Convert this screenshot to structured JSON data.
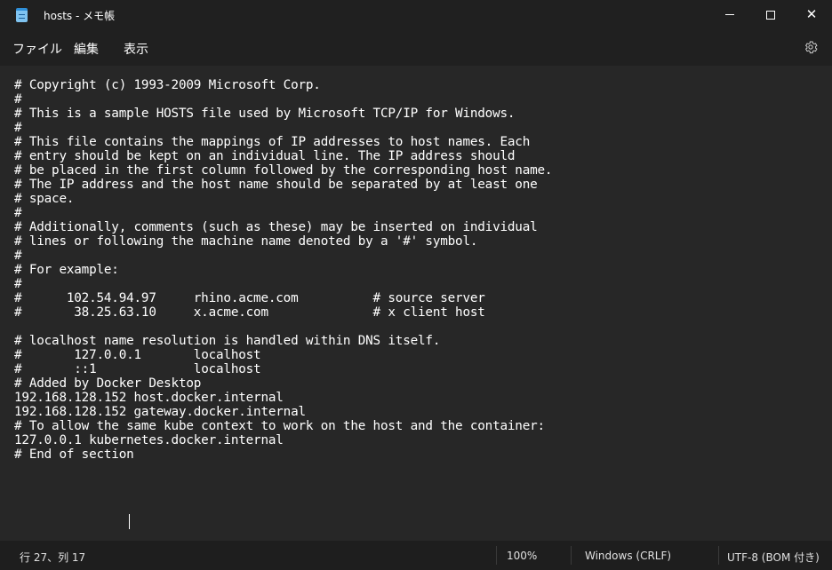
{
  "window": {
    "title": "hosts - メモ帳"
  },
  "menu": {
    "file": "ファイル",
    "edit": "編集",
    "view": "表示"
  },
  "editor": {
    "content": "# Copyright (c) 1993-2009 Microsoft Corp.\n#\n# This is a sample HOSTS file used by Microsoft TCP/IP for Windows.\n#\n# This file contains the mappings of IP addresses to host names. Each\n# entry should be kept on an individual line. The IP address should\n# be placed in the first column followed by the corresponding host name.\n# The IP address and the host name should be separated by at least one\n# space.\n#\n# Additionally, comments (such as these) may be inserted on individual\n# lines or following the machine name denoted by a '#' symbol.\n#\n# For example:\n#\n#      102.54.94.97     rhino.acme.com          # source server\n#       38.25.63.10     x.acme.com              # x client host\n\n# localhost name resolution is handled within DNS itself.\n#\t127.0.0.1       localhost\n#\t::1             localhost\n# Added by Docker Desktop\n192.168.128.152 host.docker.internal\n192.168.128.152 gateway.docker.internal\n# To allow the same kube context to work on the host and the container:\n127.0.0.1 kubernetes.docker.internal\n# End of section"
  },
  "status": {
    "position": "行 27、列 17",
    "zoom": "100%",
    "line_ending": "Windows (CRLF)",
    "encoding": "UTF-8 (BOM 付き)"
  },
  "icons": {
    "app": "notepad-icon",
    "settings": "gear-icon",
    "minimize": "minimize-icon",
    "maximize": "maximize-icon",
    "close": "close-icon"
  },
  "colors": {
    "background": "#272727",
    "chrome": "#202020",
    "text": "#ffffff"
  }
}
